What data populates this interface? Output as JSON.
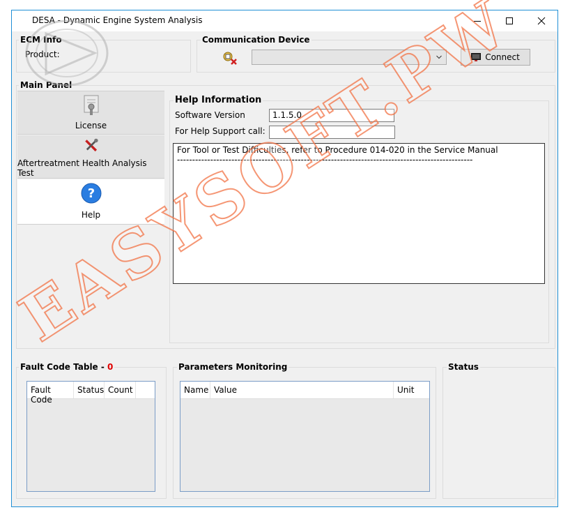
{
  "window": {
    "title": "DESA - Dynamic Engine System Analysis",
    "controls": [
      "minimize-icon",
      "maximize-icon",
      "close-icon"
    ]
  },
  "ecm_info": {
    "label": "ECM Info",
    "product_label": "Product:"
  },
  "communication": {
    "label": "Communication Device",
    "device_value": "",
    "connect_label": "Connect"
  },
  "main_panel": {
    "label": "Main Panel",
    "nav": [
      {
        "label": "License",
        "icon": "license-icon"
      },
      {
        "label": "Aftertreatment Health Analysis Test",
        "icon": "tools-icon"
      },
      {
        "label": "Help",
        "icon": "help-icon"
      }
    ]
  },
  "help_info": {
    "title": "Help Information",
    "software_version_label": "Software Version",
    "software_version_value": "1.1.5.0",
    "support_label": "For Help Support call:",
    "support_value": "",
    "notes_line1": "For Tool or Test Difficulties, refer to Procedure 014-020 in the Service Manual",
    "notes_line2": "---------------------------------------------------------------------------------------------------"
  },
  "fault_codes": {
    "label": "Fault Code Table - ",
    "count": "0",
    "columns": [
      "Fault Code",
      "Status",
      "Count"
    ]
  },
  "parameters": {
    "label": "Parameters Monitoring",
    "columns": [
      "Name",
      "Value",
      "Unit"
    ]
  },
  "status": {
    "label": "Status"
  },
  "watermark": "EASYSOFT.PW",
  "colors": {
    "window_border": "#1f8fd6",
    "fault_count": "#e00000",
    "grid_border": "#7a9cc6",
    "watermark": "#f27346"
  }
}
